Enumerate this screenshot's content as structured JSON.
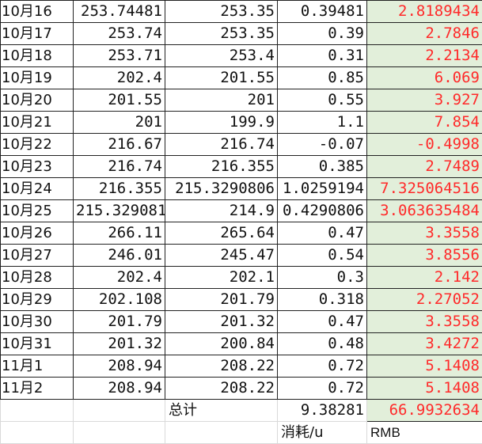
{
  "rows": [
    {
      "date": "10月16",
      "a": "253.74481",
      "b": "253.35",
      "c": "0.39481",
      "rmb": "2.8189434"
    },
    {
      "date": "10月17",
      "a": "253.74",
      "b": "253.35",
      "c": "0.39",
      "rmb": "2.7846"
    },
    {
      "date": "10月18",
      "a": "253.71",
      "b": "253.4",
      "c": "0.31",
      "rmb": "2.2134"
    },
    {
      "date": "10月19",
      "a": "202.4",
      "b": "201.55",
      "c": "0.85",
      "rmb": "6.069"
    },
    {
      "date": "10月20",
      "a": "201.55",
      "b": "201",
      "c": "0.55",
      "rmb": "3.927"
    },
    {
      "date": "10月21",
      "a": "201",
      "b": "199.9",
      "c": "1.1",
      "rmb": "7.854"
    },
    {
      "date": "10月22",
      "a": "216.67",
      "b": "216.74",
      "c": "-0.07",
      "rmb": "-0.4998"
    },
    {
      "date": "10月23",
      "a": "216.74",
      "b": "216.355",
      "c": "0.385",
      "rmb": "2.7489"
    },
    {
      "date": "10月24",
      "a": "216.355",
      "b": "215.3290806",
      "c": "1.0259194",
      "rmb": "7.325064516"
    },
    {
      "date": "10月25",
      "a": "215.329081",
      "b": "214.9",
      "c": "0.4290806",
      "rmb": "3.063635484"
    },
    {
      "date": "10月26",
      "a": "266.11",
      "b": "265.64",
      "c": "0.47",
      "rmb": "3.3558"
    },
    {
      "date": "10月27",
      "a": "246.01",
      "b": "245.47",
      "c": "0.54",
      "rmb": "3.8556"
    },
    {
      "date": "10月28",
      "a": "202.4",
      "b": "202.1",
      "c": "0.3",
      "rmb": "2.142"
    },
    {
      "date": "10月29",
      "a": "202.108",
      "b": "201.79",
      "c": "0.318",
      "rmb": "2.27052"
    },
    {
      "date": "10月30",
      "a": "201.79",
      "b": "201.32",
      "c": "0.47",
      "rmb": "3.3558"
    },
    {
      "date": "10月31",
      "a": "201.32",
      "b": "200.84",
      "c": "0.48",
      "rmb": "3.4272"
    },
    {
      "date": "11月1",
      "a": "208.94",
      "b": "208.22",
      "c": "0.72",
      "rmb": "5.1408"
    },
    {
      "date": "11月2",
      "a": "208.94",
      "b": "208.22",
      "c": "0.72",
      "rmb": "5.1408"
    }
  ],
  "footer": {
    "total_label": "总计",
    "total_consumption": "9.38281",
    "total_rmb": "66.9932634",
    "unit_label": "消耗/u",
    "rmb_label": "RMB"
  },
  "colors": {
    "rmb_fill": "#e2efda",
    "rmb_text": "#ff2a2a"
  }
}
